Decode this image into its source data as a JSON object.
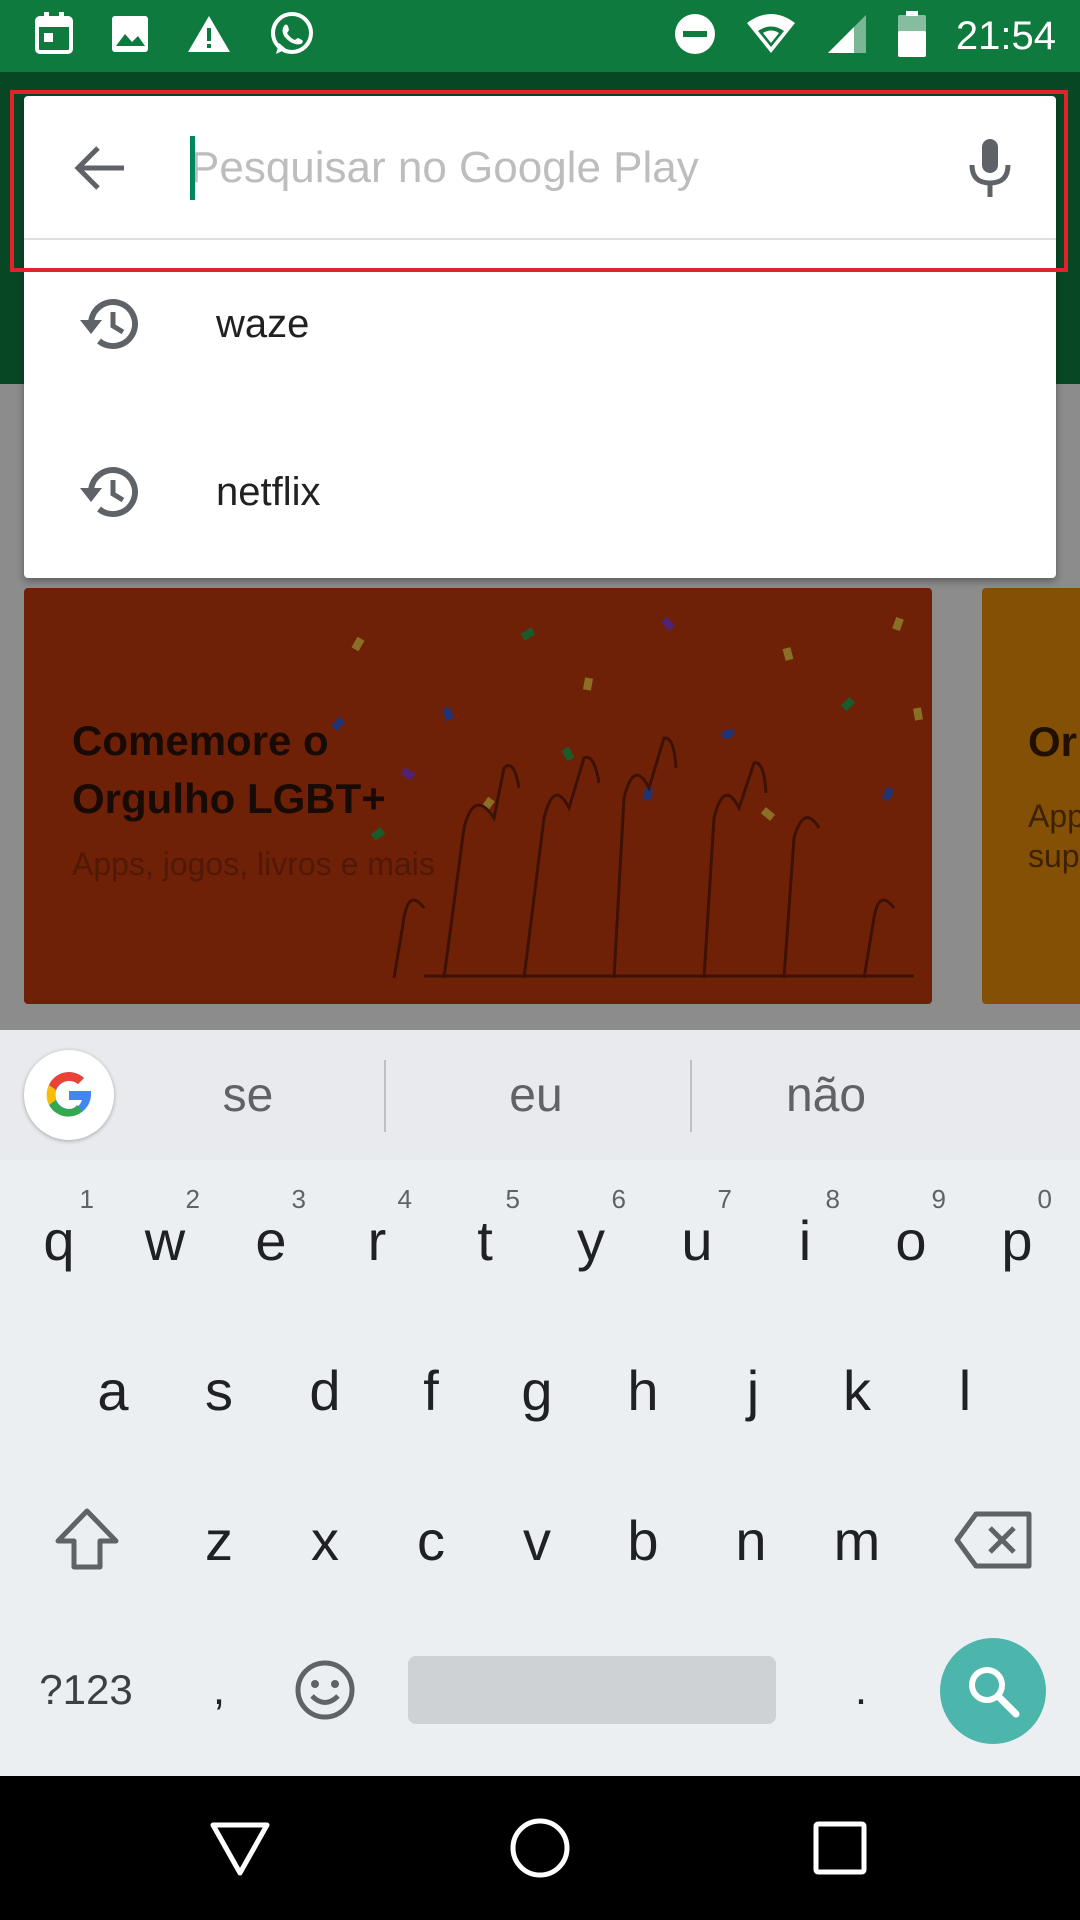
{
  "status_bar": {
    "time": "21:54",
    "left_icons": [
      "calendar-icon",
      "image-icon",
      "warning-icon",
      "whatsapp-icon"
    ],
    "right_icons": [
      "do-not-disturb-icon",
      "wifi-icon",
      "signal-icon",
      "battery-icon"
    ]
  },
  "search": {
    "placeholder": "Pesquisar no Google Play",
    "value": ""
  },
  "suggestions": [
    {
      "label": "waze",
      "icon": "history-icon"
    },
    {
      "label": "netflix",
      "icon": "history-icon"
    }
  ],
  "background": {
    "promo_title": "Comemore o Orgulho LGBT+",
    "promo_subtitle": "Apps, jogos, livros e mais",
    "promo2_title": "Or",
    "promo2_subtitle": "App sup"
  },
  "keyboard": {
    "suggestions": [
      "se",
      "eu",
      "não"
    ],
    "row1": [
      "q",
      "w",
      "e",
      "r",
      "t",
      "y",
      "u",
      "i",
      "o",
      "p"
    ],
    "row1_numbers": [
      "1",
      "2",
      "3",
      "4",
      "5",
      "6",
      "7",
      "8",
      "9",
      "0"
    ],
    "row2": [
      "a",
      "s",
      "d",
      "f",
      "g",
      "h",
      "j",
      "k",
      "l"
    ],
    "row3": [
      "z",
      "x",
      "c",
      "v",
      "b",
      "n",
      "m"
    ],
    "symbols_label": "?123",
    "comma": ",",
    "period": "."
  },
  "colors": {
    "brand_green": "#0f7a3e",
    "accent_teal": "#4db6ac",
    "highlight_red": "#e3232b"
  }
}
